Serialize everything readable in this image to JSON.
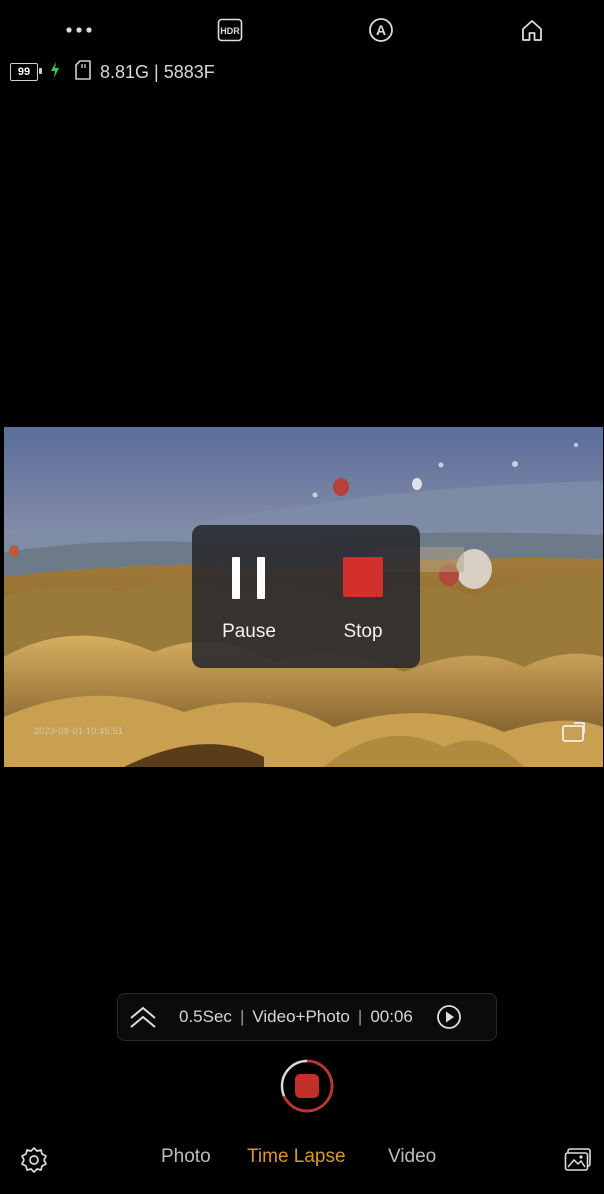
{
  "top_bar": {
    "icons": [
      "more-icon",
      "hdr-icon",
      "auto-mode-icon",
      "home-icon"
    ],
    "hdr_label": "HDR",
    "auto_label": "A"
  },
  "status": {
    "battery": "99",
    "charging": true,
    "storage": "8.81G | 5883F"
  },
  "preview": {
    "timestamp": "2023-08-01 10:45:51"
  },
  "recording_panel": {
    "pause_label": "Pause",
    "stop_label": "Stop",
    "stop_color": "#d3302c"
  },
  "info_bar": {
    "interval": "0.5Sec",
    "output": "Video+Photo",
    "duration": "00:06"
  },
  "modes": {
    "items": [
      "Photo",
      "Time Lapse",
      "Video"
    ],
    "active": "Time Lapse",
    "active_color": "#d79a2b"
  },
  "colors": {
    "accent": "#d79a2b",
    "record_red": "#c2302a"
  }
}
